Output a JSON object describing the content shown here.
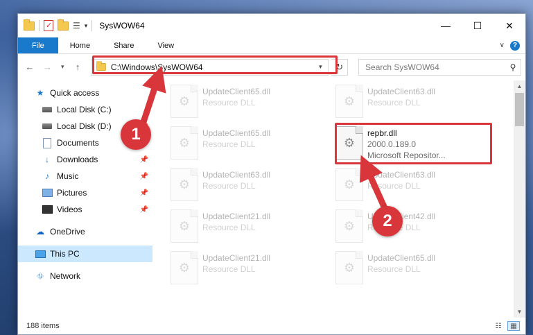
{
  "titlebar": {
    "title": "SysWOW64",
    "minimize": "—",
    "maximize": "☐",
    "close": "✕"
  },
  "ribbon": {
    "tabs": [
      "File",
      "Home",
      "Share",
      "View"
    ],
    "help": "?"
  },
  "nav": {
    "back": "←",
    "forward": "→",
    "recent": "▾",
    "up": "↑",
    "address": "C:\\Windows\\SysWOW64",
    "search_placeholder": "Search SysWOW64"
  },
  "sidebar": {
    "quick_access": "Quick access",
    "items": [
      {
        "label": "Local Disk (C:)",
        "icon": "disk-icon"
      },
      {
        "label": "Local Disk (D:)",
        "icon": "disk-icon"
      },
      {
        "label": "Documents",
        "icon": "documents-icon"
      },
      {
        "label": "Downloads",
        "icon": "downloads-icon"
      },
      {
        "label": "Music",
        "icon": "music-icon"
      },
      {
        "label": "Pictures",
        "icon": "pictures-icon"
      },
      {
        "label": "Videos",
        "icon": "videos-icon"
      }
    ],
    "onedrive": "OneDrive",
    "this_pc": "This PC",
    "network": "Network"
  },
  "files": {
    "selected": {
      "name": "repbr.dll",
      "line2": "2000.0.189.0",
      "line3": "Microsoft Repositor..."
    },
    "ghosts": [
      {
        "name": "UpdateClient65.dll",
        "sub": "Resource DLL"
      },
      {
        "name": "UpdateClient63.dll",
        "sub": "Resource DLL"
      },
      {
        "name": "UpdateClient65.dll",
        "sub": "Resource DLL"
      },
      {
        "name": "UpdateClient63.dll",
        "sub": "Resource DLL"
      },
      {
        "name": "UpdateClient63.dll",
        "sub": "Resource DLL"
      },
      {
        "name": "UpdateClient21.dll",
        "sub": "Resource DLL"
      },
      {
        "name": "UpdateClient42.dll",
        "sub": "Resource DLL"
      },
      {
        "name": "UpdateClient21.dll",
        "sub": "Resource DLL"
      },
      {
        "name": "UpdateClient65.dll",
        "sub": "Resource DLL"
      }
    ]
  },
  "status": {
    "items": "188 items"
  },
  "annotations": {
    "step1": "1",
    "step2": "2",
    "color": "#d9363b"
  }
}
